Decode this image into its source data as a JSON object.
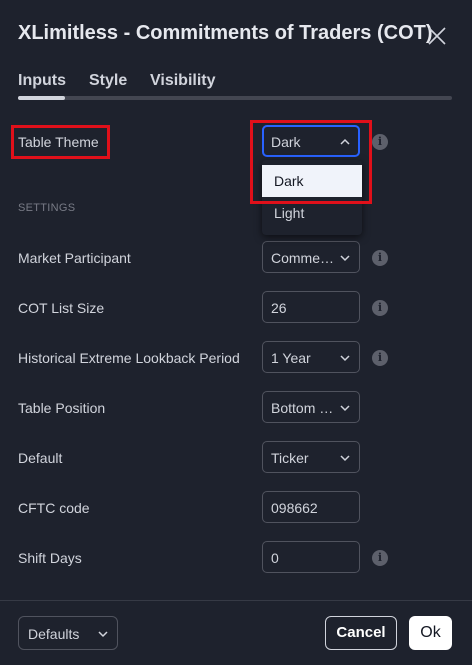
{
  "dialog": {
    "title": "XLimitless - Commitments of Traders (COT)",
    "tabs": [
      {
        "label": "Inputs",
        "active": true
      },
      {
        "label": "Style",
        "active": false
      },
      {
        "label": "Visibility",
        "active": false
      }
    ]
  },
  "inputs": {
    "table_theme": {
      "label": "Table Theme",
      "value": "Dark",
      "dropdown_open": true,
      "options": [
        "Dark",
        "Light"
      ],
      "selected_option": "Dark"
    },
    "section_label": "SETTINGS",
    "market_participant": {
      "label": "Market Participant",
      "value": "Commercials"
    },
    "cot_list_size": {
      "label": "COT List Size",
      "value": "26"
    },
    "historical_lookback": {
      "label": "Historical Extreme Lookback Period",
      "value": "1 Year"
    },
    "table_position": {
      "label": "Table Position",
      "value": "Bottom Right"
    },
    "default": {
      "label": "Default",
      "value": "Ticker"
    },
    "cftc_code": {
      "label": "CFTC code",
      "value": "098662"
    },
    "shift_days": {
      "label": "Shift Days",
      "value": "0"
    }
  },
  "footer": {
    "defaults_label": "Defaults",
    "cancel_label": "Cancel",
    "ok_label": "Ok"
  },
  "icons": {
    "info": "i",
    "close": "close-icon",
    "chevron": "chevron-down-icon"
  },
  "colors": {
    "background": "#1e222d",
    "text": "#d1d4dc",
    "focus_border": "#2962ff",
    "highlight_box": "#e0101a",
    "info_icon": "#5d606b"
  }
}
